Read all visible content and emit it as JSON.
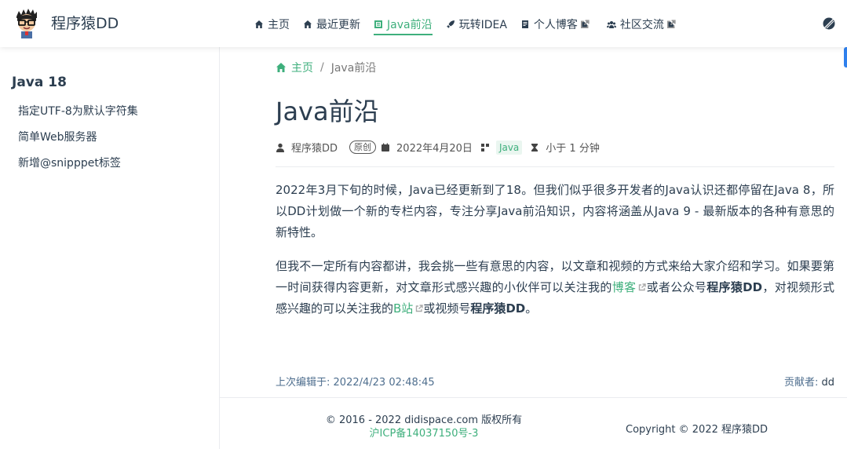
{
  "site": {
    "title": "程序猿DD"
  },
  "nav": {
    "items": [
      {
        "label": "主页",
        "icon": "home-icon"
      },
      {
        "label": "最近更新",
        "icon": "home-icon"
      },
      {
        "label": "Java前沿",
        "icon": "book-icon",
        "active": true
      },
      {
        "label": "玩转IDEA",
        "icon": "rocket-icon"
      },
      {
        "label": "个人博客",
        "icon": "blog-icon",
        "external": true
      },
      {
        "label": "社区交流",
        "icon": "community-icon",
        "external": true
      }
    ]
  },
  "sidebar": {
    "heading": "Java 18",
    "links": [
      "指定UTF-8为默认字符集",
      "简单Web服务器",
      "新增@snipppet标签"
    ]
  },
  "breadcrumb": {
    "home": "主页",
    "sep": "/",
    "current": "Java前沿"
  },
  "page": {
    "title": "Java前沿",
    "author": "程序猿DD",
    "original_badge": "原创",
    "date": "2022年4月20日",
    "tag": "Java",
    "read_time": "小于 1 分钟"
  },
  "content": {
    "p1": "2022年3月下旬的时候，Java已经更新到了18。但我们似乎很多开发者的Java认识还都停留在Java 8，所以DD计划做一个新的专栏内容，专注分享Java前沿知识，内容将涵盖从Java 9 - 最新版本的各种有意思的新特性。",
    "p2_a": "但我不一定所有内容都讲，我会挑一些有意思的内容，以文章和视频的方式来给大家介绍和学习。如果要第一时间获得内容更新，对文章形式感兴趣的小伙伴可以关注我的",
    "p2_link1": "博客",
    "p2_b": "或者公众号",
    "p2_bold1": "程序猿DD",
    "p2_c": "，对视频形式感兴趣的可以关注我的",
    "p2_link2": "B站",
    "p2_d": "或视频号",
    "p2_bold2": "程序猿DD",
    "p2_e": "。"
  },
  "page_meta": {
    "last_edit_label": "上次编辑于:",
    "last_edit_value": "2022/4/23 02:48:45",
    "contrib_label": "贡献者:",
    "contrib_value": "dd"
  },
  "footer": {
    "copyright": "© 2016 - 2022 didispace.com 版权所有",
    "icp": "沪ICP备14037150号-3",
    "right": "Copyright © 2022 程序猿DD"
  },
  "colors": {
    "accent": "#3eaf7c",
    "text": "#2c3e50",
    "side_tab": "#2f80ed"
  }
}
